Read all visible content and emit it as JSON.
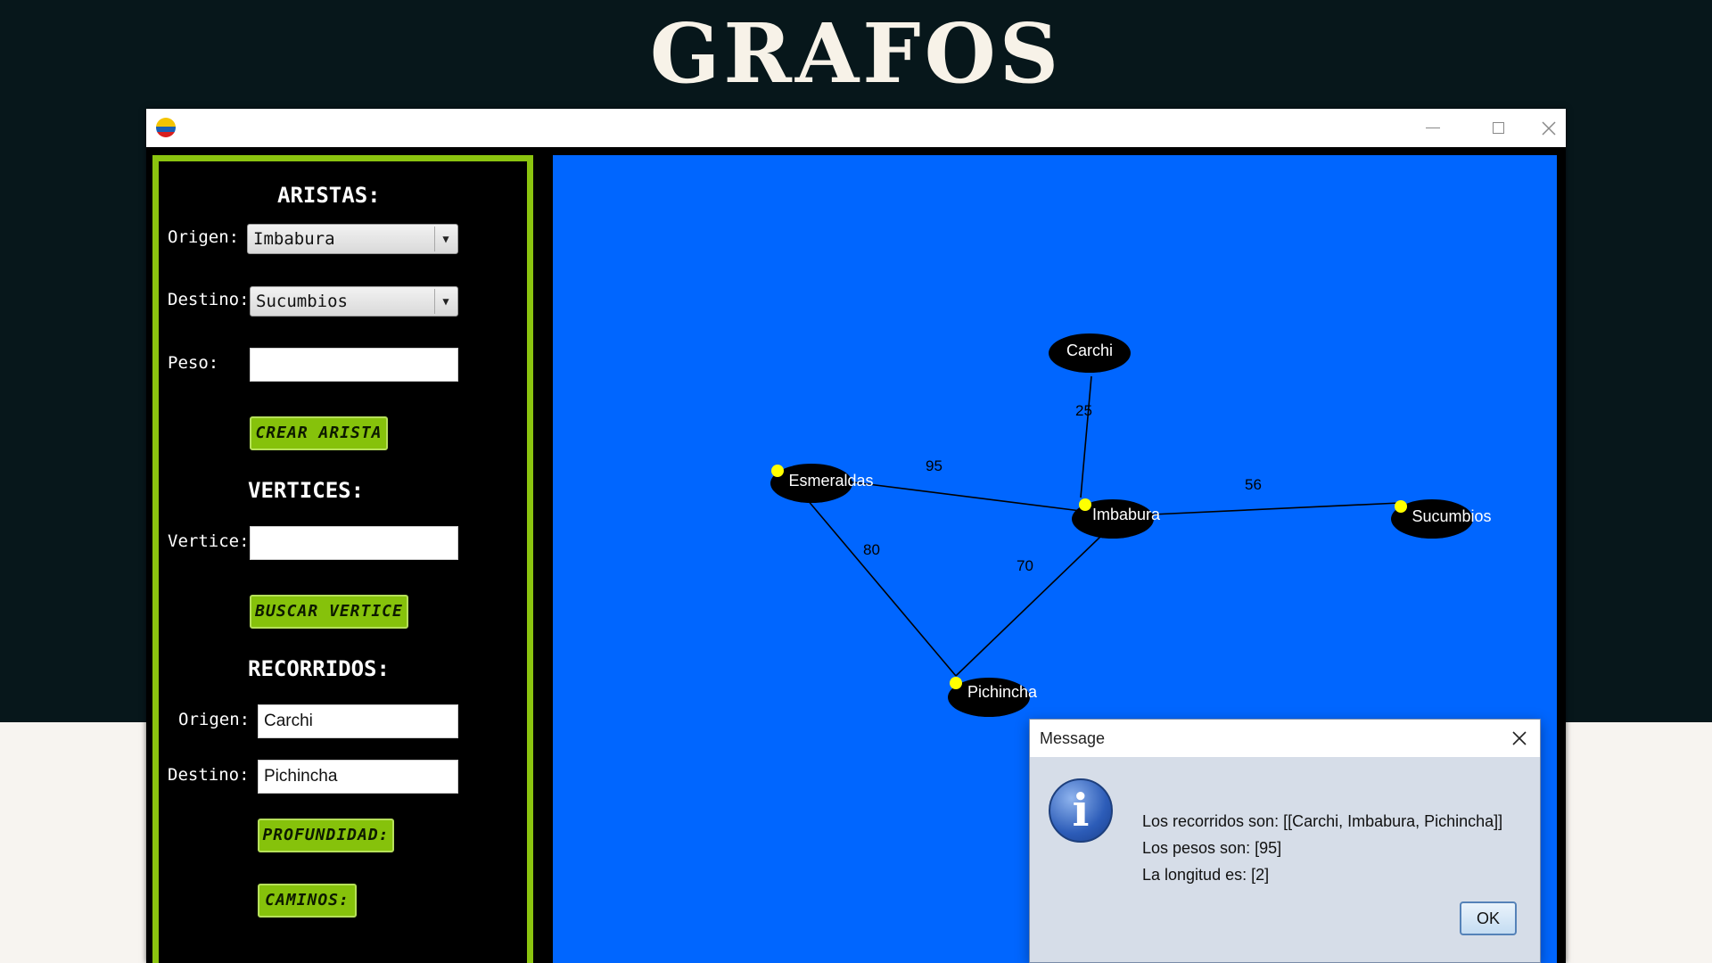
{
  "page": {
    "title": "GRAFOS"
  },
  "colors": {
    "panel_border": "#8bc40f",
    "button_green": "#86c20b",
    "canvas_blue": "#0066ff",
    "node_marker": "#ffff00"
  },
  "aristas": {
    "heading": "ARISTAS:",
    "origen_label": "Origen:",
    "origen_value": "Imbabura",
    "destino_label": "Destino:",
    "destino_value": "Sucumbios",
    "peso_label": "Peso:",
    "peso_value": "",
    "crear_button": "CREAR ARISTA"
  },
  "vertices": {
    "heading": "VERTICES:",
    "vertice_label": "Vertice:",
    "vertice_value": "",
    "buscar_button": "BUSCAR VERTICE"
  },
  "recorridos": {
    "heading": "RECORRIDOS:",
    "origen_label": "Origen:",
    "origen_value": "Carchi",
    "destino_label": "Destino:",
    "destino_value": "Pichincha",
    "profundidad_button": "PROFUNDIDAD:",
    "caminos_button": "CAMINOS:"
  },
  "graph": {
    "nodes": [
      {
        "id": "carchi",
        "label": "Carchi",
        "marker": false
      },
      {
        "id": "esmeraldas",
        "label": "Esmeraldas",
        "marker": true
      },
      {
        "id": "imbabura",
        "label": "Imbabura",
        "marker": true
      },
      {
        "id": "sucumbios",
        "label": "Sucumbios",
        "marker": true
      },
      {
        "id": "pichincha",
        "label": "Pichincha",
        "marker": true
      }
    ],
    "edges": [
      {
        "from": "carchi",
        "to": "imbabura",
        "weight": "25"
      },
      {
        "from": "esmeraldas",
        "to": "imbabura",
        "weight": "95"
      },
      {
        "from": "imbabura",
        "to": "sucumbios",
        "weight": "56"
      },
      {
        "from": "esmeraldas",
        "to": "pichincha",
        "weight": "80"
      },
      {
        "from": "imbabura",
        "to": "pichincha",
        "weight": "70"
      }
    ]
  },
  "dialog": {
    "title": "Message",
    "icon": "info-icon",
    "lines": [
      "Los recorridos son: [[Carchi, Imbabura, Pichincha]]",
      "Los pesos son: [95]",
      "La longitud es: [2]"
    ],
    "ok_label": "OK"
  }
}
